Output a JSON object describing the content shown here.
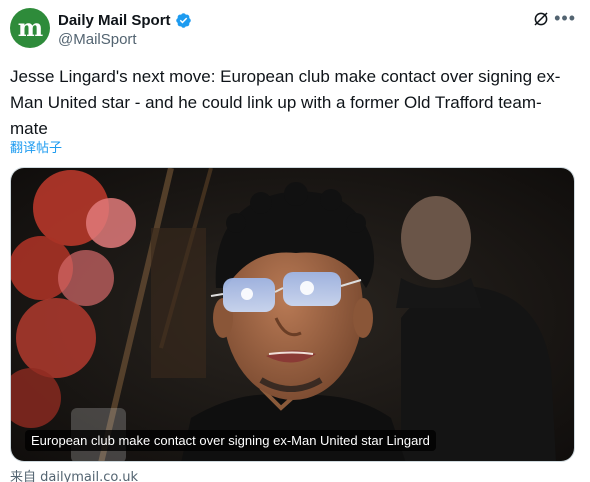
{
  "account": {
    "display_name": "Daily Mail Sport",
    "handle": "@MailSport",
    "avatar_letter": "m",
    "avatar_color": "#2e8b3a",
    "verified_color": "#1d9bf0"
  },
  "icons": {
    "verified": "verified-badge-icon",
    "grok": "grok-icon",
    "more": "more-icon"
  },
  "tweet": {
    "text": "Jesse Lingard's next move: European club make contact over signing ex-Man United star - and he could link up with a former Old Trafford team-mate",
    "translate": "翻译帖子"
  },
  "card": {
    "caption": "European club make contact over signing ex-Man United star Lingard",
    "source": "来自 dailymail.co.uk"
  }
}
